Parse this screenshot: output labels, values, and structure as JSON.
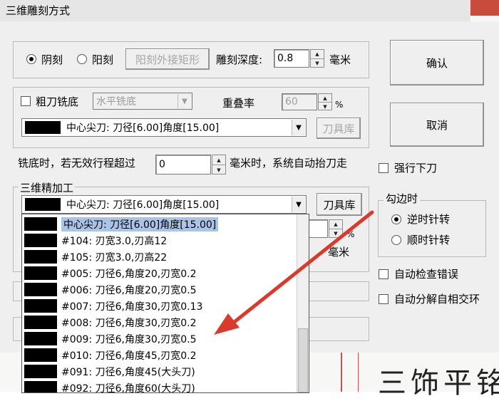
{
  "dialog": {
    "title": "三维雕刻方式"
  },
  "engrave": {
    "yin_label": "阴刻",
    "yang_label": "阳刻",
    "yang_rect_label": "阳刻外接矩形",
    "depth_label": "雕刻深度:",
    "depth_value": "0.8",
    "depth_unit": "毫米"
  },
  "rough": {
    "checkbox_label": "粗刀铣底",
    "mode_value": "水平铣底",
    "overlap_label": "重叠率",
    "overlap_value": "60",
    "overlap_unit": "%",
    "tool_value": "中心尖刀: 刀径[6.00]角度[15.00]",
    "tool_lib_label": "刀具库"
  },
  "milling": {
    "text_before": "铣底时，若无效行程超过",
    "value": "0",
    "text_after": "毫米时，系统自动抬刀走"
  },
  "finish": {
    "group_label": "三维精加工",
    "tool_value": "中心尖刀: 刀径[6.00]角度[15.00]",
    "tool_lib_label": "刀具库",
    "partial_unit_pct": "%",
    "partial_unit_mm": "毫米"
  },
  "tool_list": [
    "中心尖刀: 刀径[6.00]角度[15.00]",
    "#104: 刃宽3.0,刃高12",
    "#105: 刃宽3.0,刃高22",
    "#005: 刀径6,角度20,刃宽0.2",
    "#006: 刀径6,角度20,刃宽0.5",
    "#007: 刀径6,角度30,刃宽0.13",
    "#008: 刀径6,角度30,刃宽0.2",
    "#009: 刀径6,角度30,刃宽0.5",
    "#010: 刀径6,角度45,刃宽0.2",
    "#091: 刀径6,角度45(大头刀)",
    "#092: 刀径6,角度60(大头刀)"
  ],
  "buttons": {
    "confirm": "确认",
    "cancel": "取消"
  },
  "options": {
    "force_down": "强行下刀",
    "edge_group": "勾边时",
    "ccw": "逆时针转",
    "cw": "顺时针转",
    "auto_check": "自动检查错误",
    "auto_split": "自动分解自相交环"
  },
  "background": {
    "doc_text": "三饰平铭"
  },
  "colors": {
    "annotation_arrow": "#d93a2b",
    "selection": "#a9c4e6",
    "close_button": "#c84b3c"
  }
}
